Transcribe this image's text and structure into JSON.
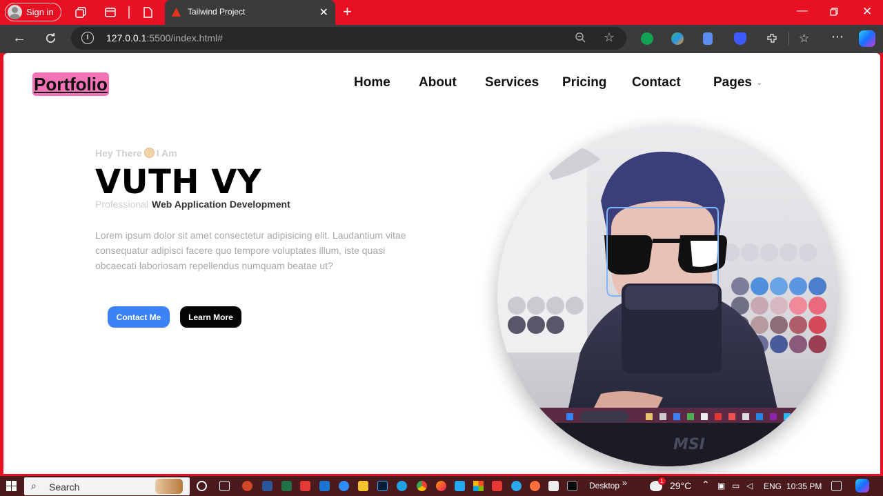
{
  "browser": {
    "signin_label": "Sign in",
    "tab_title": "Tailwind Project",
    "url_host": "127.0.0.1",
    "url_rest": ":5500/index.html#"
  },
  "page": {
    "logo": "Portfolio",
    "nav": [
      "Home",
      "About",
      "Services",
      "Pricing",
      "Contact",
      "Pages"
    ],
    "greeting_pre": "Hey There",
    "greeting_post": "I Am",
    "name": "VUTH VY",
    "role_prefix": "Professional",
    "role": "Web Application Development",
    "description": "Lorem ipsum dolor sit amet consectetur adipisicing elit. Laudantium vitae consequatur adipisci facere quo tempore voluptates illum, iste quasi obcaecati laboriosam repellendus numquam beatae ut?",
    "contact_button": "Contact Me",
    "learn_button": "Learn More",
    "photo_monitor_brand": "MSI"
  },
  "taskbar": {
    "search": "Search",
    "desktop": "Desktop",
    "temperature": "29°C",
    "language": "ENG",
    "time": "10:35 PM",
    "weather_badge": "1"
  },
  "colors": {
    "browser_frame": "#e81123",
    "logo_highlight": "#f472b6",
    "contact_button": "#3b82f6",
    "learn_button": "#050505"
  }
}
